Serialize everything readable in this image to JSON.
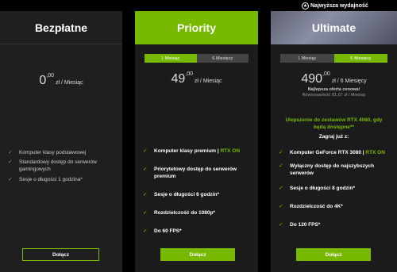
{
  "top_badge": {
    "label": "Najwyższa wydajność",
    "icon": "award-icon"
  },
  "plans": {
    "free": {
      "name": "Bezpłatne",
      "price_int": "0",
      "price_dec": ",00",
      "price_suffix": " zł / Miesiąc",
      "features": [
        "Komputer klasy podstawowej",
        "Standardowy dostęp do serwerów gamingowych",
        "Sesje o długości 1 godzina*"
      ],
      "button": "Dołącz"
    },
    "priority": {
      "name": "Priority",
      "toggle": [
        "1 Miesiąc",
        "6 Miesięcy"
      ],
      "price_int": "49",
      "price_dec": ",00",
      "price_suffix": " zł / Miesiąc",
      "features": [
        {
          "pre": "Komputer klasy premium | ",
          "hl": "RTX ON",
          "post": ""
        },
        {
          "pre": "Priorytetowy dostęp do serwerów premium",
          "hl": "",
          "post": ""
        },
        {
          "pre": "Sesje o długości 6 godzin*",
          "hl": "",
          "post": ""
        },
        {
          "pre": "Rozdzielczość do 1080p*",
          "hl": "",
          "post": ""
        },
        {
          "pre": "Do 60 FPS*",
          "hl": "",
          "post": ""
        }
      ],
      "button": "Dołącz"
    },
    "ultimate": {
      "name": "Ultimate",
      "toggle": [
        "1 Miesiąc",
        "6 Miesięcy"
      ],
      "price_int": "490",
      "price_dec": ",00",
      "price_suffix": " zł / 6 Miesięcy",
      "note1": "Najlepsza oferta cenowa!",
      "note2": "Równowartość 81,67 zł / Miesiąc",
      "upgrade": "Ulepszenie do zestawów RTX 4080, gdy będą dostępne**",
      "plus": "Zagraj już z:",
      "features": [
        {
          "pre": "Komputer GeForce RTX 3080 | ",
          "hl": "RTX ON",
          "post": ""
        },
        {
          "pre": "Wyłączny dostęp do najszybszych serwerów",
          "hl": "",
          "post": ""
        },
        {
          "pre": "Sesje o długości 8 godzin*",
          "hl": "",
          "post": ""
        },
        {
          "pre": "Rozdzielczość do 4K*",
          "hl": "",
          "post": ""
        },
        {
          "pre": "Do 120 FPS*",
          "hl": "",
          "post": ""
        }
      ],
      "button": "Dołącz"
    }
  },
  "colors": {
    "accent": "#76b900",
    "card": "#1c1c1c",
    "bg": "#000000"
  }
}
